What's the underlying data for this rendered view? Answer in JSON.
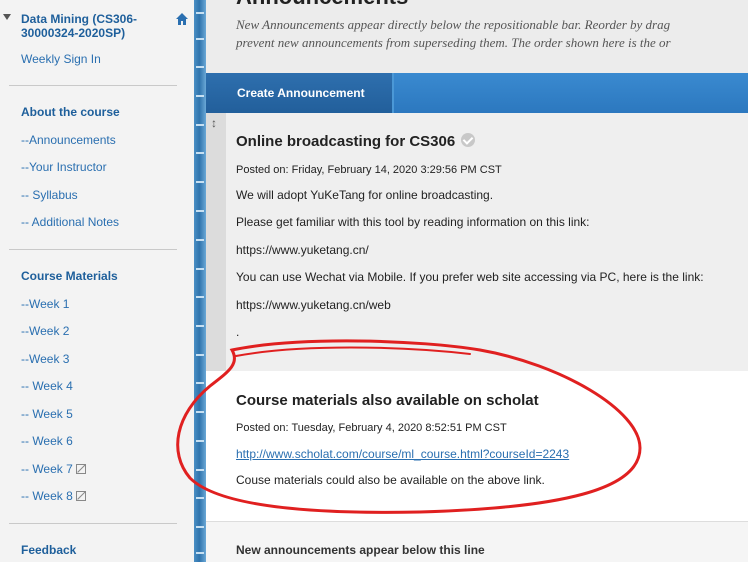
{
  "sidebar": {
    "course_title": "Data Mining (CS306-30000324-2020SP)",
    "weekly_sign_in": "Weekly Sign In",
    "sections": [
      {
        "heading": "About the course",
        "items": [
          "--Announcements",
          "--Your Instructor",
          "-- Syllabus",
          "-- Additional Notes"
        ]
      },
      {
        "heading": "Course Materials",
        "items": [
          "--Week 1",
          "--Week 2",
          "--Week 3",
          "-- Week 4",
          "-- Week 5",
          "-- Week 6",
          "-- Week 7",
          "-- Week 8"
        ]
      }
    ],
    "feedback": "Feedback"
  },
  "page": {
    "title": "Announcements",
    "intro_line1": "New Announcements appear directly below the repositionable bar. Reorder by drag",
    "intro_line2": "prevent new announcements from superseding them. The order shown here is the or"
  },
  "toolbar": {
    "create_label": "Create Announcement"
  },
  "announcements": [
    {
      "title": "Online broadcasting for CS306",
      "posted": "Posted on: Friday, February 14, 2020 3:29:56 PM CST",
      "lines": [
        "We will adopt YuKeTang for online broadcasting.",
        "Please get familiar with this tool by reading information on this link:",
        "https://www.yuketang.cn/",
        "You can use Wechat via Mobile. If you prefer web site accessing via PC, here is the link:",
        "https://www.yuketang.cn/web",
        "."
      ]
    },
    {
      "title": "Course materials also available on scholat",
      "posted": "Posted on: Tuesday, February 4, 2020 8:52:51 PM CST",
      "link": "http://www.scholat.com/course/ml_course.html?courseId=2243",
      "body": "Couse materials could also be available on the above link."
    }
  ],
  "footer": {
    "new_below": "New announcements appear below this line"
  },
  "colors": {
    "nav_blue": "#2a6fb0",
    "toolbar_blue": "#2c78bf",
    "annotation_red": "#e02020"
  }
}
